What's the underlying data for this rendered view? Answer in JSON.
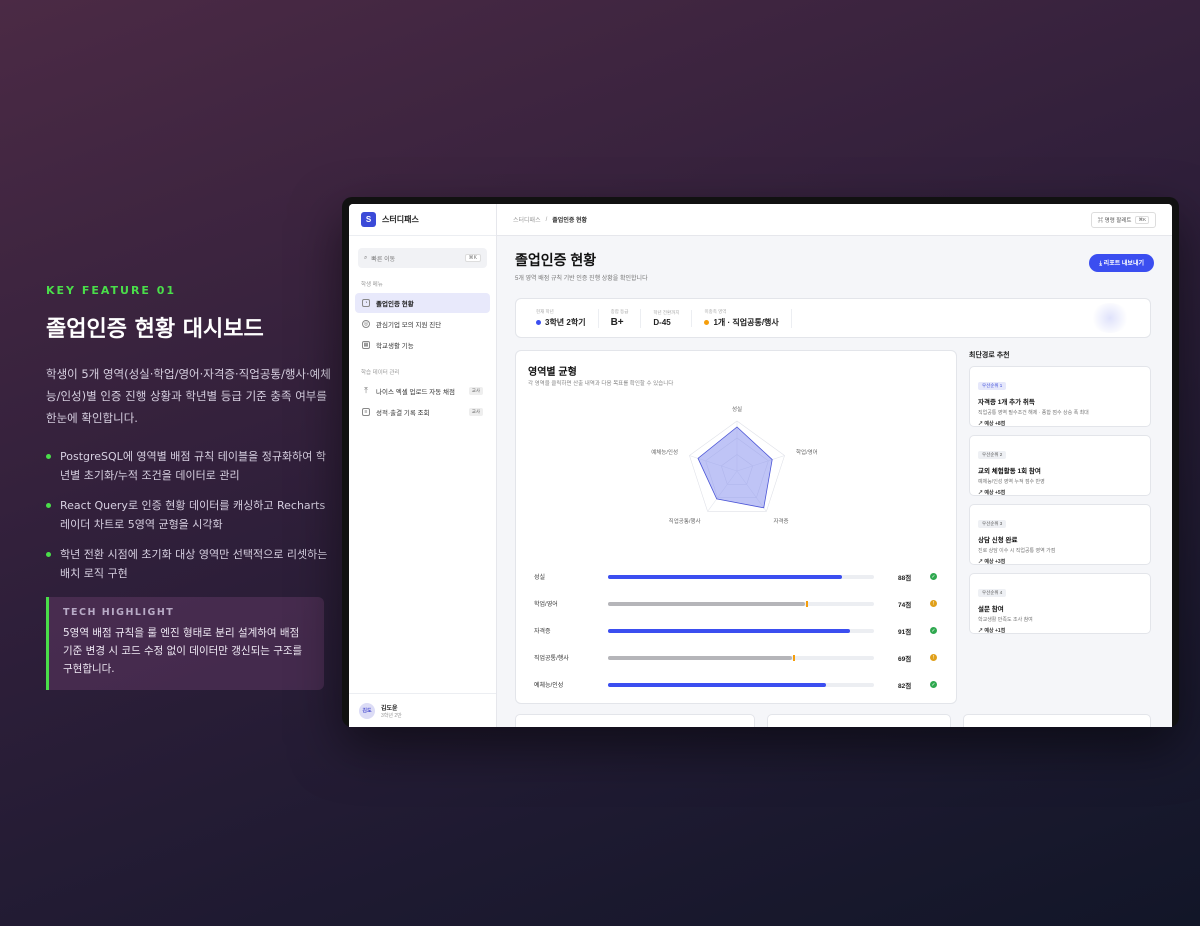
{
  "left": {
    "kicker": "KEY FEATURE 01",
    "headline": "졸업인증 현황 대시보드",
    "description": "학생이 5개 영역(성실·학업/영어·자격증·직업공통/행사·예체능/인성)별 인증 진행 상황과 학년별 등급 기준 충족 여부를 한눈에 확인합니다.",
    "bullets": [
      "PostgreSQL에 영역별 배점 규칙 테이블을 정규화하여 학년별 초기화/누적 조건을 데이터로 관리",
      "React Query로 인증 현황 데이터를 캐싱하고 Recharts 레이더 차트로 5영역 균형을 시각화",
      "학년 전환 시점에 초기화 대상 영역만 선택적으로 리셋하는 배치 로직 구현"
    ],
    "tech": {
      "title": "TECH HIGHLIGHT",
      "body": "5영역 배점 규칙을 룰 엔진 형태로 분리 설계하여 배점 기준 변경 시 코드 수정 없이 데이터만 갱신되는 구조를 구현합니다."
    }
  },
  "app": {
    "logo_letter": "S",
    "brand": "스터디패스",
    "search": {
      "placeholder": "빠른 이동",
      "shortcut": "⌘K"
    },
    "sections": [
      {
        "label": "학생 메뉴",
        "items": [
          {
            "label": "졸업인증 현황",
            "icon": "gauge-icon",
            "active": true
          },
          {
            "label": "관심기업 모의 지원 진단",
            "icon": "target-icon"
          },
          {
            "label": "학교생활 기능",
            "icon": "calendar-icon"
          }
        ]
      },
      {
        "label": "학습 데이터 관리",
        "items": [
          {
            "label": "나이스 엑셀 업로드 자동 채점",
            "icon": "upload-icon",
            "badge": "교사"
          },
          {
            "label": "성적·출결 기록 조회",
            "icon": "document-icon",
            "badge": "교사"
          }
        ]
      }
    ],
    "user": {
      "initials": "김도",
      "name": "김도윤",
      "grade": "3학년 2반"
    },
    "breadcrumb": {
      "root": "스터디패스",
      "sep": "/",
      "current": "졸업인증 현황"
    },
    "palette": {
      "label": "⌘ 명령 팔레트",
      "shortcut": "⌘K"
    },
    "page": {
      "title": "졸업인증 현황",
      "subtitle": "5개 영역 배점 규칙 기반 인증 진행 상황을 확인합니다",
      "export": "⤓ 리포트 내보내기"
    },
    "summary": [
      {
        "label": "현재 학년",
        "value": "3학년 2학기",
        "dot": "#3b4ef0"
      },
      {
        "label": "종합 등급",
        "value": "B+"
      },
      {
        "label": "학년 전환까지",
        "value": "D-45"
      },
      {
        "label": "미충족 영역",
        "value": "1개 · 직업공통/행사",
        "dot": "#f59e0b"
      }
    ],
    "balance": {
      "title": "영역별 균형",
      "subtitle": "각 영역을 클릭하면 산출 내역과 다음 목표를 확인할 수 있습니다"
    },
    "recommend": {
      "title": "최단경로 추천",
      "items": [
        {
          "badge": "우선순위 1",
          "title": "자격증 1개 추가 취득",
          "desc": "직업공통 영역 필수조건 해제 · 종합 점수 상승 폭 최대",
          "effect": "↗ 예상 +8점"
        },
        {
          "badge": "우선순위 2",
          "title": "교외 체험활동 1회 참여",
          "desc": "예체능/인성 영역 누적 점수 반영",
          "effect": "↗ 예상 +5점"
        },
        {
          "badge": "우선순위 3",
          "title": "상담 신청 완료",
          "desc": "진로 상담 이수 시 직업공통 영역 가점",
          "effect": "↗ 예상 +3점"
        },
        {
          "badge": "우선순위 4",
          "title": "설문 참여",
          "desc": "학교생활 만족도 조사 참여",
          "effect": "↗ 예상 +1점"
        }
      ]
    }
  },
  "chart_data": {
    "type": "radar",
    "categories": [
      "성실",
      "학업/영어",
      "자격증",
      "직업공통/행사",
      "예체능/인성"
    ],
    "values": [
      88,
      74,
      91,
      69,
      82
    ],
    "score_labels": [
      "88점",
      "74점",
      "91점",
      "69점",
      "82점"
    ],
    "status": [
      "met",
      "warn",
      "met",
      "warn",
      "met"
    ],
    "ylim": [
      0,
      100
    ],
    "colors": {
      "met": "#2fa84f",
      "warn": "#e0a01a",
      "fill_met": "#3b4ef0",
      "fill_warn": "#b5b5b9",
      "radar": "#8b93ee"
    }
  }
}
